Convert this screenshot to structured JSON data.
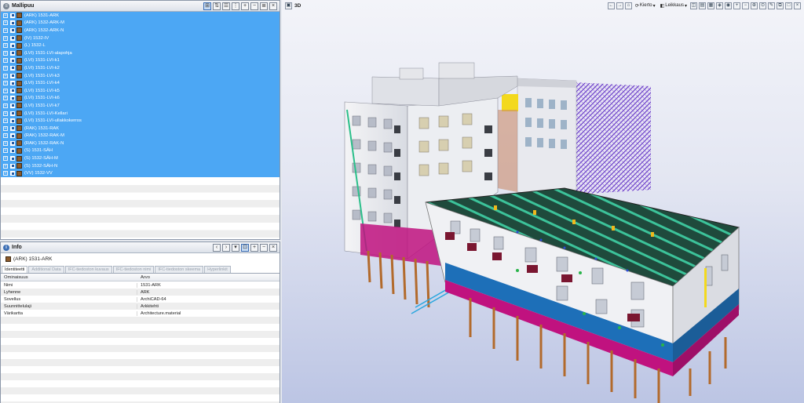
{
  "tree": {
    "title": "Mallipuu",
    "models": [
      "(ARK) 1531-ARK",
      "(ARK) 1532-ARK-M",
      "(ARK) 1532-ARK-N",
      "(IV) 1532-IV",
      "(L) 1532-L",
      "(LVI) 1531-LVI-alapohja",
      "(LVI) 1531-LVI-k1",
      "(LVI) 1531-LVI-k2",
      "(LVI) 1531-LVI-k3",
      "(LVI) 1531-LVI-k4",
      "(LVI) 1531-LVI-k5",
      "(LVI) 1531-LVI-k6",
      "(LVI) 1531-LVI-k7",
      "(LVI) 1531-LVI-Kellari",
      "(LVI) 1531-LVI-ullakkokerros",
      "(RAK) 1531-RAK",
      "(RAK) 1532-RAK-M",
      "(RAK) 1532-RAK-N",
      "(S) 1531-SÄH",
      "(S) 1532-SÄH-M",
      "(S) 1532-SÄH-N",
      "(VV) 1532-VV"
    ]
  },
  "info": {
    "title": "Info",
    "selected_model": "(ARK) 1531-ARK",
    "tabs": [
      "Identiteetti",
      "Additional Data",
      "IFC-tiedoston kuvaus",
      "IFC-tiedoston nimi",
      "IFC-tiedoston skeema",
      "Hyperlinkit"
    ],
    "active_tab": 0,
    "columns": [
      "Ominaisuus",
      "Arvo"
    ],
    "rows": [
      [
        "Nimi",
        "1531-ARK"
      ],
      [
        "Lyhenne",
        "ARK"
      ],
      [
        "Sovellus",
        "ArchiCAD-64"
      ],
      [
        "Suunnittelulaji",
        "Arkkitehti"
      ],
      [
        "Värikartta",
        "Architecture.material"
      ]
    ]
  },
  "viewport": {
    "title": "3D",
    "rotate_label": "Kierto",
    "section_label": "Leikkaus"
  },
  "colors": {
    "selection": "#4ca7f4",
    "roof": "#1f4a3c",
    "roof_stripes": "#3cc39a",
    "facade_band": "#1d6fb8",
    "foundation": "#c0127f",
    "piles": "#b26a2c",
    "hvac_overlay": "#6a3fc8"
  }
}
